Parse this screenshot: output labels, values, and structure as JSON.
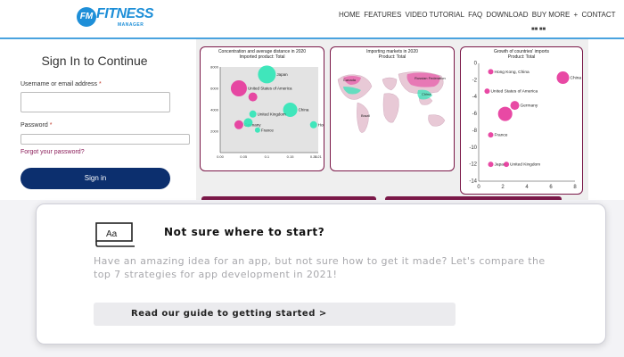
{
  "header": {
    "logo_badge": "FM",
    "logo_word": "FITNESS",
    "logo_sub": "MANAGER",
    "nav": [
      "HOME",
      "FEATURES",
      "VIDEO TUTORIAL",
      "FAQ",
      "DOWNLOAD",
      "BUY MORE",
      "CONTACT"
    ],
    "nav_more_symbol": "+",
    "flags": "■■ ■■"
  },
  "signin": {
    "title": "Sign In to Continue",
    "username_label": "Username or email address",
    "password_label": "Password",
    "required_mark": "*",
    "forgot_link": "Forgot your password?",
    "button": "Sign in"
  },
  "dashboard": {
    "colors": {
      "teal": "#2de6b6",
      "pink": "#e5359a",
      "frame": "#7a1848"
    },
    "chart1_title_l1": "Concentration and average distance in 2020",
    "chart1_title_l2": "Imported product: Total",
    "chart2_title_l1": "Importing markets in 2020",
    "chart2_title_l2": "Product: Total",
    "chart3_title_l1": "Growth of countries' imports",
    "chart3_title_l2": "Product: Total",
    "map_labels": [
      "Russian Federation",
      "Canada",
      "China",
      "Brazil"
    ]
  },
  "chart_data": [
    {
      "type": "scatter",
      "title": "Concentration and average distance in 2020",
      "subtitle": "Imported product: Total",
      "xlim": [
        0,
        0.21
      ],
      "ylim": [
        0,
        8000
      ],
      "x_ticks": [
        "0.00",
        "0.05",
        "0.1",
        "0.15",
        "0.20",
        "0.21"
      ],
      "y_ticks": [
        "8000",
        "6000",
        "4000",
        "2000"
      ],
      "points": [
        {
          "label": "Japan",
          "x": 0.1,
          "y": 7300,
          "size": 10,
          "color": "#2de6b6"
        },
        {
          "label": "United States of America",
          "x": 0.04,
          "y": 6000,
          "size": 9,
          "color": "#e5359a"
        },
        {
          "label": "",
          "x": 0.07,
          "y": 5200,
          "size": 5,
          "color": "#e5359a"
        },
        {
          "label": "China",
          "x": 0.15,
          "y": 4000,
          "size": 8,
          "color": "#2de6b6"
        },
        {
          "label": "United Kingdom",
          "x": 0.07,
          "y": 3600,
          "size": 4,
          "color": "#2de6b6"
        },
        {
          "label": "Germany",
          "x": 0.04,
          "y": 2600,
          "size": 5,
          "color": "#e5359a"
        },
        {
          "label": "",
          "x": 0.06,
          "y": 2800,
          "size": 5,
          "color": "#2de6b6"
        },
        {
          "label": "Hong Kong, China",
          "x": 0.2,
          "y": 2600,
          "size": 4,
          "color": "#2de6b6"
        },
        {
          "label": "France",
          "x": 0.08,
          "y": 2100,
          "size": 3,
          "color": "#2de6b6"
        }
      ]
    },
    {
      "type": "scatter",
      "title": "Growth of countries' imports",
      "subtitle": "Product: Total",
      "xlim": [
        0,
        8
      ],
      "ylim": [
        -14,
        0
      ],
      "x_ticks": [
        "0",
        "2",
        "4",
        "6",
        "8"
      ],
      "y_ticks": [
        "0",
        "-2",
        "-4",
        "-6",
        "-8",
        "-10",
        "-12",
        "-14"
      ],
      "points": [
        {
          "label": "Hong Kong, China",
          "x": 1.0,
          "y": -1.0,
          "size": 3,
          "color": "#e5359a"
        },
        {
          "label": "China",
          "x": 7.0,
          "y": -1.7,
          "size": 7,
          "color": "#e5359a"
        },
        {
          "label": "United States of America",
          "x": 0.7,
          "y": -3.3,
          "size": 3,
          "color": "#e5359a"
        },
        {
          "label": "Germany",
          "x": 3.0,
          "y": -5.0,
          "size": 5,
          "color": "#e5359a"
        },
        {
          "label": "",
          "x": 2.2,
          "y": -6.0,
          "size": 8,
          "color": "#e5359a"
        },
        {
          "label": "France",
          "x": 1.0,
          "y": -8.5,
          "size": 3,
          "color": "#e5359a"
        },
        {
          "label": "Japan",
          "x": 1.0,
          "y": -12.0,
          "size": 3,
          "color": "#e5359a"
        },
        {
          "label": "United Kingdom",
          "x": 2.3,
          "y": -12.0,
          "size": 3,
          "color": "#e5359a"
        }
      ]
    }
  ],
  "card": {
    "title": "Not sure where to start?",
    "text": "Have an amazing idea for an app, but not sure how to get it made? Let's compare the top 7 strategies for app development in 2021!",
    "button": "Read our guide to getting started >",
    "icon_text": "Aa"
  }
}
